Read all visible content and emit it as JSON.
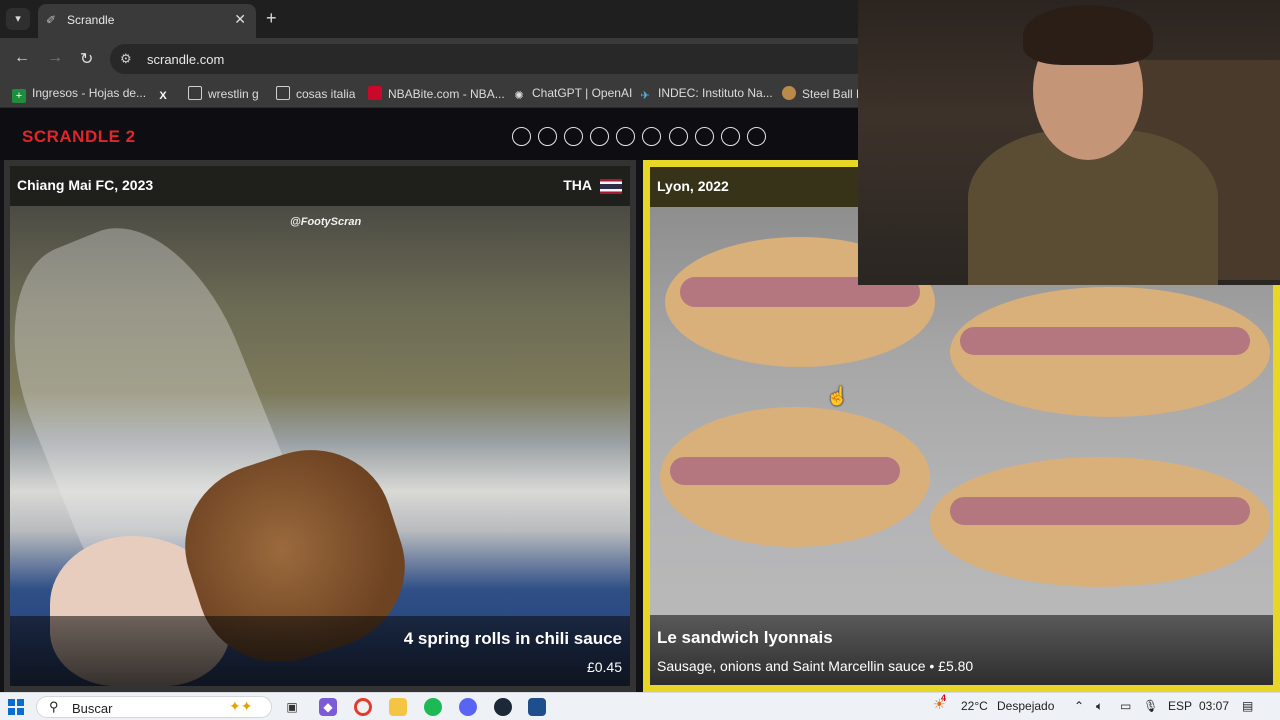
{
  "browser": {
    "tab_title": "Scrandle",
    "tab_close": "✕",
    "new_tab": "+",
    "url": "scrandle.com"
  },
  "bookmarks": [
    {
      "label": "Ingresos - Hojas de...",
      "icon": "sheets-icon",
      "color": "#1e8e3e"
    },
    {
      "label": "",
      "icon": "x-icon",
      "color": "#000000"
    },
    {
      "label": "wrestlin g",
      "icon": "folder-icon",
      "color": "#cfcfcf"
    },
    {
      "label": "cosas italia",
      "icon": "folder-icon",
      "color": "#cfcfcf"
    },
    {
      "label": "NBABite.com - NBA...",
      "icon": "nba-icon",
      "color": "#c9082a"
    },
    {
      "label": "ChatGPT | OpenAI",
      "icon": "openai-icon",
      "color": "#dddddd"
    },
    {
      "label": "INDEC: Instituto Na...",
      "icon": "indec-icon",
      "color": "#58b7e6"
    },
    {
      "label": "Steel Ball R",
      "icon": "steel-ball-icon",
      "color": "#b98a4a"
    }
  ],
  "page": {
    "logo": "SCRANDLE 2",
    "progress_dots": 10,
    "left_card": {
      "location": "Chiang Mai FC, 2023",
      "country": "THA",
      "watermark": "@FootyScran",
      "name": "4 spring rolls in chili sauce",
      "price": "£0.45"
    },
    "right_card": {
      "location": "Lyon, 2022",
      "name": "Le sandwich lyonnais",
      "description": "Sausage, onions and Saint Marcellin sauce • £5.80",
      "highlight_color": "#e8d627"
    }
  },
  "taskbar": {
    "search_placeholder": "Buscar",
    "weather": "22°C",
    "weather_desc": "Despejado",
    "language": "ESP",
    "time": "03:07",
    "notification_badge": "4"
  }
}
